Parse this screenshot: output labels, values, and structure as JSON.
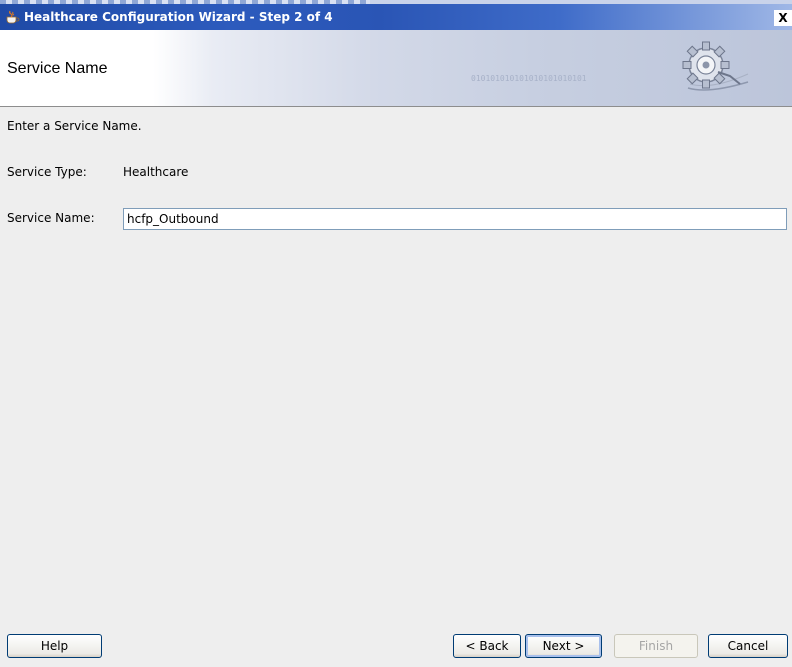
{
  "window": {
    "title": "Healthcare Configuration Wizard - Step 2 of 4",
    "close_label": "X"
  },
  "header": {
    "title": "Service Name",
    "binary_text": "010101010101010101010101"
  },
  "content": {
    "instruction": "Enter a Service Name.",
    "service_type_label": "Service Type:",
    "service_type_value": "Healthcare",
    "service_name_label": "Service Name:",
    "service_name_value": "hcfp_Outbound"
  },
  "buttons": {
    "help": "Help",
    "back": "< Back",
    "next": "Next >",
    "finish": "Finish",
    "cancel": "Cancel"
  }
}
